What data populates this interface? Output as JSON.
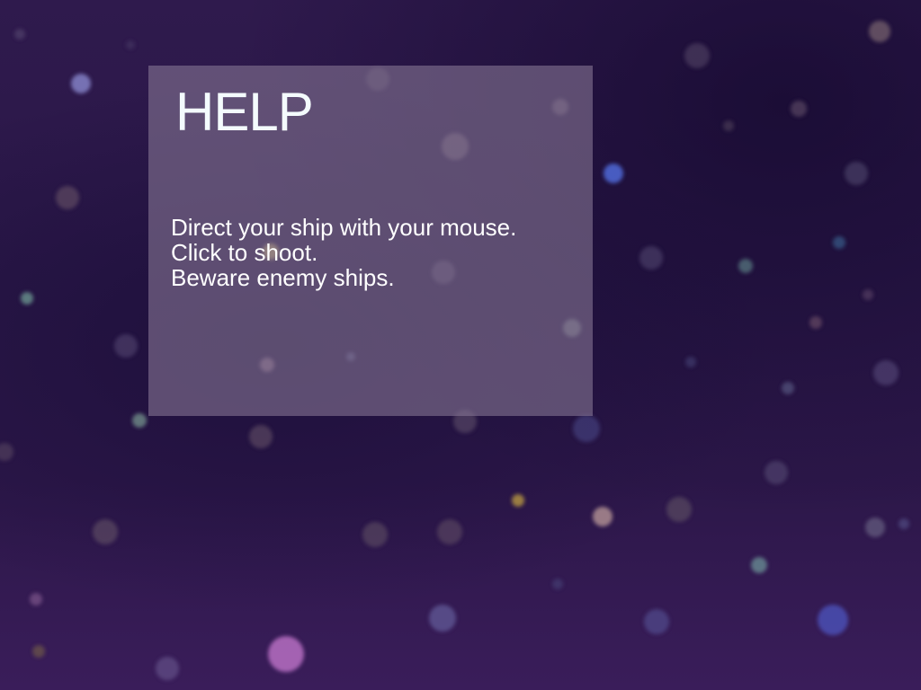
{
  "help": {
    "title": "HELP",
    "lines": [
      "Direct your ship with your mouse.",
      "Click to shoot.",
      "Beware enemy ships."
    ]
  }
}
